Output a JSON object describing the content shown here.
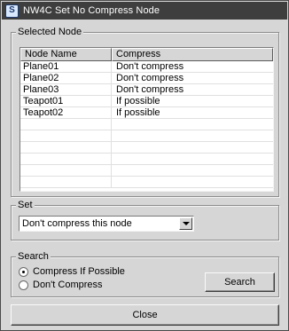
{
  "window": {
    "title": "NW4C Set No Compress Node",
    "app_icon_glyph": "S"
  },
  "selected_node": {
    "label": "Selected Node",
    "columns": [
      "Node Name",
      "Compress"
    ],
    "rows": [
      {
        "name": "Plane01",
        "compress": "Don't compress"
      },
      {
        "name": "Plane02",
        "compress": "Don't compress"
      },
      {
        "name": "Plane03",
        "compress": "Don't compress"
      },
      {
        "name": "Teapot01",
        "compress": "If possible"
      },
      {
        "name": "Teapot02",
        "compress": "If possible"
      }
    ]
  },
  "set": {
    "label": "Set",
    "selected": "Don't compress this node"
  },
  "search": {
    "label": "Search",
    "options": [
      {
        "label": "Compress If Possible",
        "checked": true
      },
      {
        "label": "Don't Compress",
        "checked": false
      }
    ],
    "button_label": "Search"
  },
  "close_label": "Close",
  "colors": {
    "title_bar": "#3e3e3e",
    "window_bg": "#d6d6d6"
  },
  "icons": {
    "app": "max-app-icon",
    "dropdown": "chevron-down-icon"
  }
}
